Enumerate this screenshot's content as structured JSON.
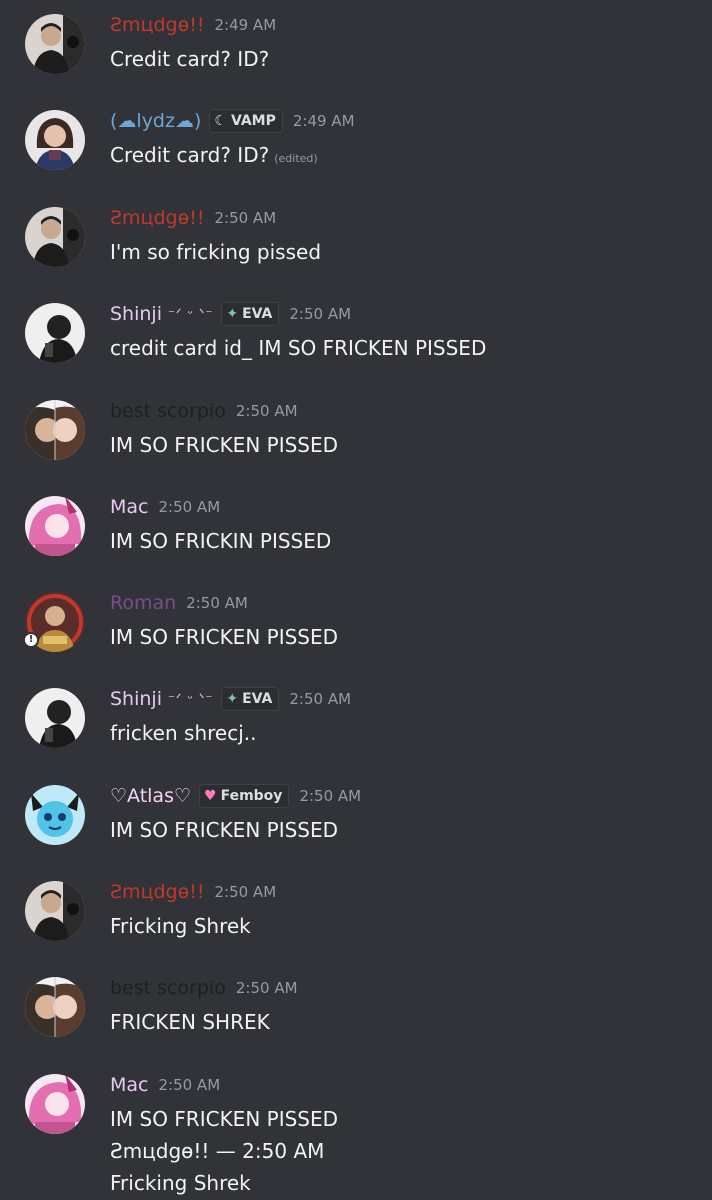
{
  "messages": [
    {
      "author": "Ƨmцdgɵ!!",
      "name_color": "#c0392b",
      "time": "2:49 AM",
      "text": "Credit card? ID?"
    },
    {
      "author": "(☁lydz☁)",
      "name_color": "#6ea6d8",
      "tag": "VAMP",
      "tag_icon": "crescent-icon",
      "time": "2:49 AM",
      "text": "Credit card? ID?",
      "edited": "(edited)"
    },
    {
      "author": "Ƨmцdgɵ!!",
      "name_color": "#c0392b",
      "time": "2:50 AM",
      "text": "I'm so fricking pissed"
    },
    {
      "author": "Shinji",
      "name_color": "#e6c8f2",
      "name_deco": "⁻ᐟ ᵕ ᐠ⁻",
      "tag": "EVA",
      "tag_icon": "sparkle-icon",
      "time": "2:50 AM",
      "text": "credit card id_ IM SO FRICKEN PISSED"
    },
    {
      "author": "best scorpio",
      "name_color": "#1e1f22",
      "time": "2:50 AM",
      "text": "IM SO FRICKEN PISSED"
    },
    {
      "author": "Mac",
      "name_color": "#e6c8f2",
      "time": "2:50 AM",
      "text": "IM SO FRICKIN PISSED"
    },
    {
      "author": "Roman",
      "name_color": "#7a4c8c",
      "time": "2:50 AM",
      "text": "IM SO FRICKEN PISSED"
    },
    {
      "author": "Shinji",
      "name_color": "#e6c8f2",
      "name_deco": "⁻ᐟ ᵕ ᐠ⁻",
      "tag": "EVA",
      "tag_icon": "sparkle-icon",
      "time": "2:50 AM",
      "text": "fricken shrecj.."
    },
    {
      "author": "♡Atlas♡",
      "name_color": "#f2d5f5",
      "tag": "Femboy",
      "tag_icon": "heart-icon",
      "time": "2:50 AM",
      "text": "IM SO FRICKEN PISSED"
    },
    {
      "author": "Ƨmцdgɵ!!",
      "name_color": "#c0392b",
      "time": "2:50 AM",
      "text": "Fricking Shrek"
    },
    {
      "author": "best scorpio",
      "name_color": "#1e1f22",
      "time": "2:50 AM",
      "text": "FRICKEN SHREK"
    },
    {
      "author": "Mac",
      "name_color": "#e6c8f2",
      "time": "2:50 AM",
      "text": "IM SO FRICKEN PISSED",
      "extra_lines": [
        "Ƨmцdgɵ!! — 2:50 AM",
        "Fricking Shrek"
      ]
    }
  ]
}
